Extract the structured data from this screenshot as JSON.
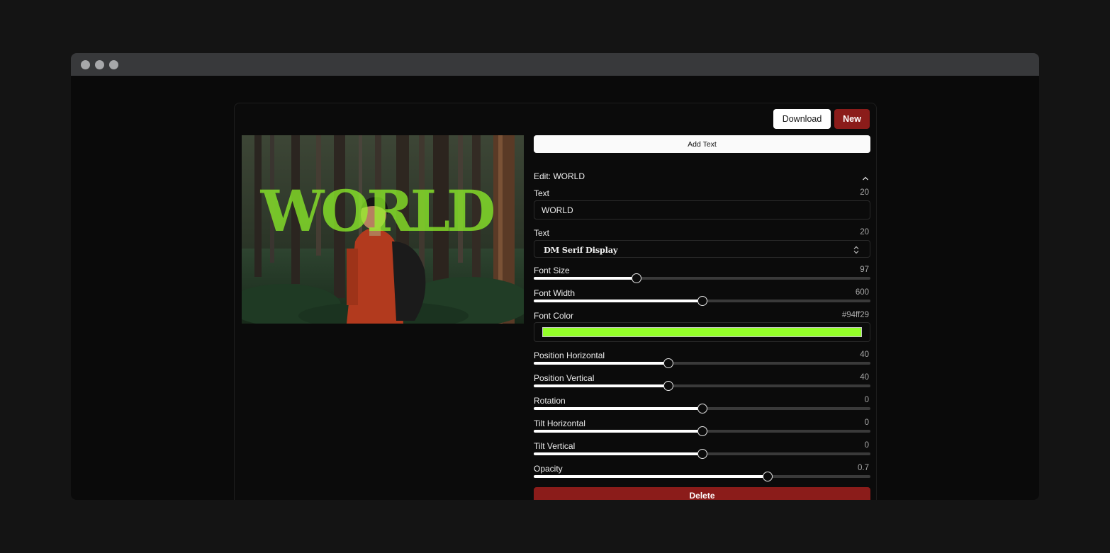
{
  "toolbar": {
    "download_label": "Download",
    "new_label": "New"
  },
  "canvas": {
    "overlay_text": "WORLD",
    "font_color": "#94ff29",
    "opacity": 0.7
  },
  "controls": {
    "add_text_label": "Add Text",
    "edit_title": "Edit: WORLD",
    "text": {
      "label": "Text",
      "count": "20",
      "value": "WORLD"
    },
    "font": {
      "label": "Text",
      "count": "20",
      "value": "DM Serif Display"
    },
    "font_size": {
      "label": "Font Size",
      "value": "97",
      "fraction": 0.305
    },
    "font_width": {
      "label": "Font Width",
      "value": "600",
      "fraction": 0.5
    },
    "font_color": {
      "label": "Font Color",
      "value": "#94ff29"
    },
    "pos_h": {
      "label": "Position Horizontal",
      "value": "40",
      "fraction": 0.4
    },
    "pos_v": {
      "label": "Position Vertical",
      "value": "40",
      "fraction": 0.4
    },
    "rotation": {
      "label": "Rotation",
      "value": "0",
      "fraction": 0.5
    },
    "tilt_h": {
      "label": "Tilt Horizontal",
      "value": "0",
      "fraction": 0.5
    },
    "tilt_v": {
      "label": "Tilt Vertical",
      "value": "0",
      "fraction": 0.5
    },
    "opacity": {
      "label": "Opacity",
      "value": "0.7",
      "fraction": 0.695
    },
    "delete_label": "Delete"
  },
  "colors": {
    "accent_red": "#8b1c1a",
    "text_color": "#94ff29"
  },
  "icons": {
    "collapse": "chevron-up-icon",
    "select": "chevron-up-down-icon"
  }
}
